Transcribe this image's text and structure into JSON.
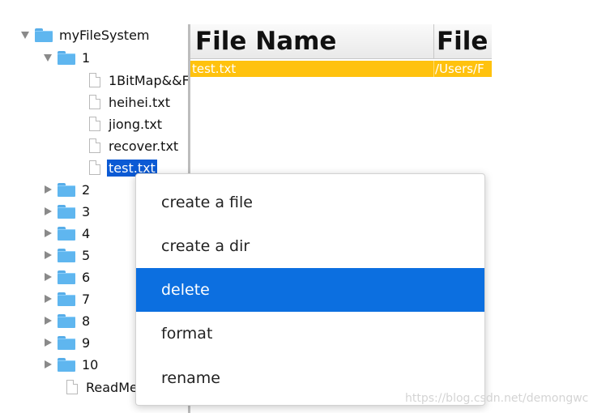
{
  "tree": {
    "root": {
      "label": "myFileSystem",
      "expanded": true
    },
    "folder_1": {
      "label": "1",
      "expanded": true,
      "files": [
        "1BitMap&&F",
        "heihei.txt",
        "jiong.txt",
        "recover.txt",
        "test.txt"
      ],
      "selected_file": "test.txt"
    },
    "collapsed_folders": [
      "2",
      "3",
      "4",
      "5",
      "6",
      "7",
      "8",
      "9",
      "10"
    ],
    "root_file": "ReadMe"
  },
  "table": {
    "columns": [
      "File Name",
      "File"
    ],
    "rows": [
      {
        "name": "test.txt",
        "path": "/Users/F"
      }
    ],
    "selected_row_color": "#ffc20e"
  },
  "context_menu": {
    "items": [
      "create a file",
      "create a dir",
      "delete",
      "format",
      "rename"
    ],
    "highlighted": "delete",
    "highlight_color": "#0c6fe0"
  },
  "watermark": "https://blog.csdn.net/demongwc",
  "icons": {
    "expanded": "triangle-down-icon",
    "collapsed": "triangle-right-icon",
    "folder": "folder-icon",
    "file": "file-icon"
  }
}
